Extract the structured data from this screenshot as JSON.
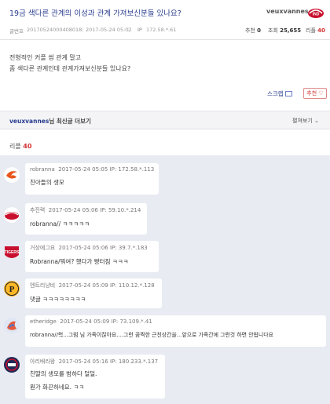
{
  "post": {
    "title": "19금 색다른 관계의 이성과 관계 가져보신분들 있나요?",
    "author": "veuxvannes",
    "meta": {
      "id_label": "글번호",
      "id_value": "20170524000408018",
      "date": "2017-05-24 05:02",
      "ip_label": "IP",
      "ip_value": "172.58.*.61",
      "rec_label": "추천",
      "rec_value": "0",
      "views_label": "조회",
      "views_value": "25,655",
      "replies_label": "리플",
      "replies_value": "40"
    },
    "body_lines": [
      "전형적인 커플 썸 관계 말고",
      "좀 색다른 관계인데 관계가져보신분들 있나요?"
    ],
    "scrap_label": "스크랩",
    "recommend_label": "추천 ♡"
  },
  "more_bar": {
    "author": "veuxvannes",
    "suffix": "님 최신글 더보기",
    "close_label": "펼쳐보기 ⌄"
  },
  "replies": {
    "label": "리플",
    "count": "40"
  },
  "comments": [
    {
      "name": "robranna",
      "date": "2017-05-24 05:05",
      "ip": "IP: 172.58.*.113",
      "lines": [
        "친아들의 생모"
      ]
    },
    {
      "name": "추진력",
      "date": "2017-05-24 05:06",
      "ip": "IP: 59.10.*.214",
      "lines": [
        "robranna// ㅋㅋㅋㅋㅋ"
      ]
    },
    {
      "name": "거상에그요",
      "date": "2017-05-24 05:06",
      "ip": "IP: 39.7.*.183",
      "lines": [
        "Robranna/뭐여? 했다가 빵터짐 ㅋㅋㅋ"
      ]
    },
    {
      "name": "엔트리냥비",
      "date": "2017-05-24 05:09",
      "ip": "IP: 110.12.*.128",
      "lines": [
        "댓글 ㅋㅋㅋㅋㅋㅋㅋㅋ"
      ]
    },
    {
      "name": "etheridge",
      "date": "2017-05-24 05:09",
      "ip": "IP: 73.109.*.41",
      "lines": [
        "robranna//헉...그럼 님 가족이잖아요....그런 끔찍한 근친상간을...앞으로 가족간에 그런것 하면 안됩니다요"
      ]
    },
    {
      "name": "아리배라왕",
      "date": "2017-05-24 05:16",
      "ip": "IP: 180.233.*.137",
      "lines": [
        "친딸의 생모를 범하다 덜덜.",
        "뭔가 화끈하네요. ㅋㅋ"
      ]
    }
  ],
  "colors": {
    "title": "#2a3d8f",
    "accent_red": "#d03030",
    "comment_area": "#e8ebf2"
  }
}
